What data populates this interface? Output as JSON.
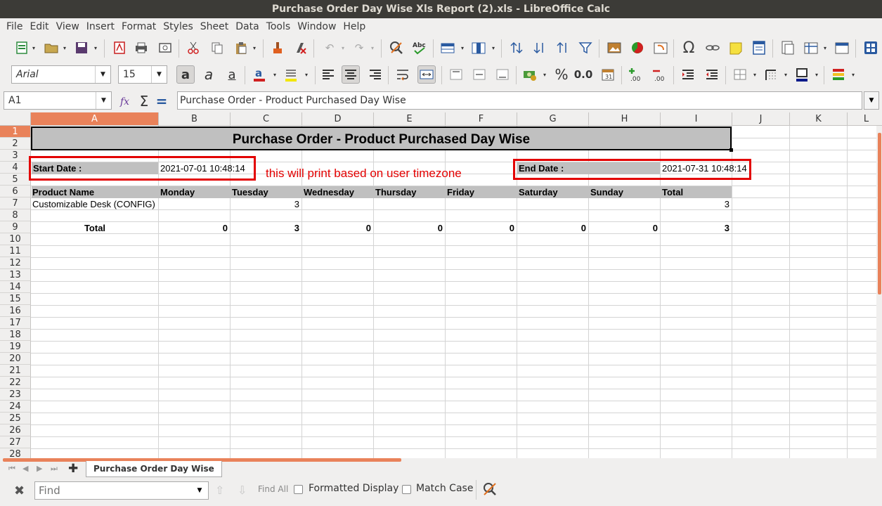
{
  "window": {
    "title": "Purchase Order Day Wise Xls Report (2).xls - LibreOffice Calc"
  },
  "menu": [
    "File",
    "Edit",
    "View",
    "Insert",
    "Format",
    "Styles",
    "Sheet",
    "Data",
    "Tools",
    "Window",
    "Help"
  ],
  "toolbar": {
    "font_name": "Arial",
    "font_size": "15"
  },
  "formula": {
    "name_box": "A1",
    "content": "Purchase Order - Product Purchased Day Wise"
  },
  "columns": [
    "A",
    "B",
    "C",
    "D",
    "E",
    "F",
    "G",
    "H",
    "I",
    "J",
    "K",
    "L"
  ],
  "rows": [
    "1",
    "2",
    "3",
    "4",
    "5",
    "6",
    "7",
    "8",
    "9",
    "10",
    "11",
    "12",
    "13",
    "14",
    "15",
    "16",
    "17",
    "18",
    "19",
    "20",
    "21",
    "22",
    "23",
    "24",
    "25",
    "26",
    "27",
    "28"
  ],
  "sheet": {
    "title": "Purchase Order - Product Purchased Day Wise",
    "start_label": "Start Date :",
    "start_value": "2021-07-01 10:48:14",
    "end_label": "End Date :",
    "end_value": "2021-07-31 10:48:14",
    "note": "this will print based on user timezone",
    "headers": [
      "Product Name",
      "Monday",
      "Tuesday",
      "Wednesday",
      "Thursday",
      "Friday",
      "Saturday",
      "Sunday",
      "Total"
    ],
    "row7": [
      "Customizable Desk (CONFIG)",
      "",
      "3",
      "",
      "",
      "",
      "",
      "",
      "3"
    ],
    "total_label": "Total",
    "totals": [
      "0",
      "3",
      "0",
      "0",
      "0",
      "0",
      "0",
      "3"
    ]
  },
  "tabs": {
    "active": "Purchase Order Day Wise"
  },
  "find": {
    "placeholder": "Find",
    "find_all": "Find All",
    "formatted_display": "Formatted Display",
    "match_case": "Match Case"
  },
  "colors": {
    "title_bg": "#3c3b37",
    "accent": "#e9825a",
    "highlight_red": "#e30000",
    "cell_gray": "#c0c0c0"
  }
}
